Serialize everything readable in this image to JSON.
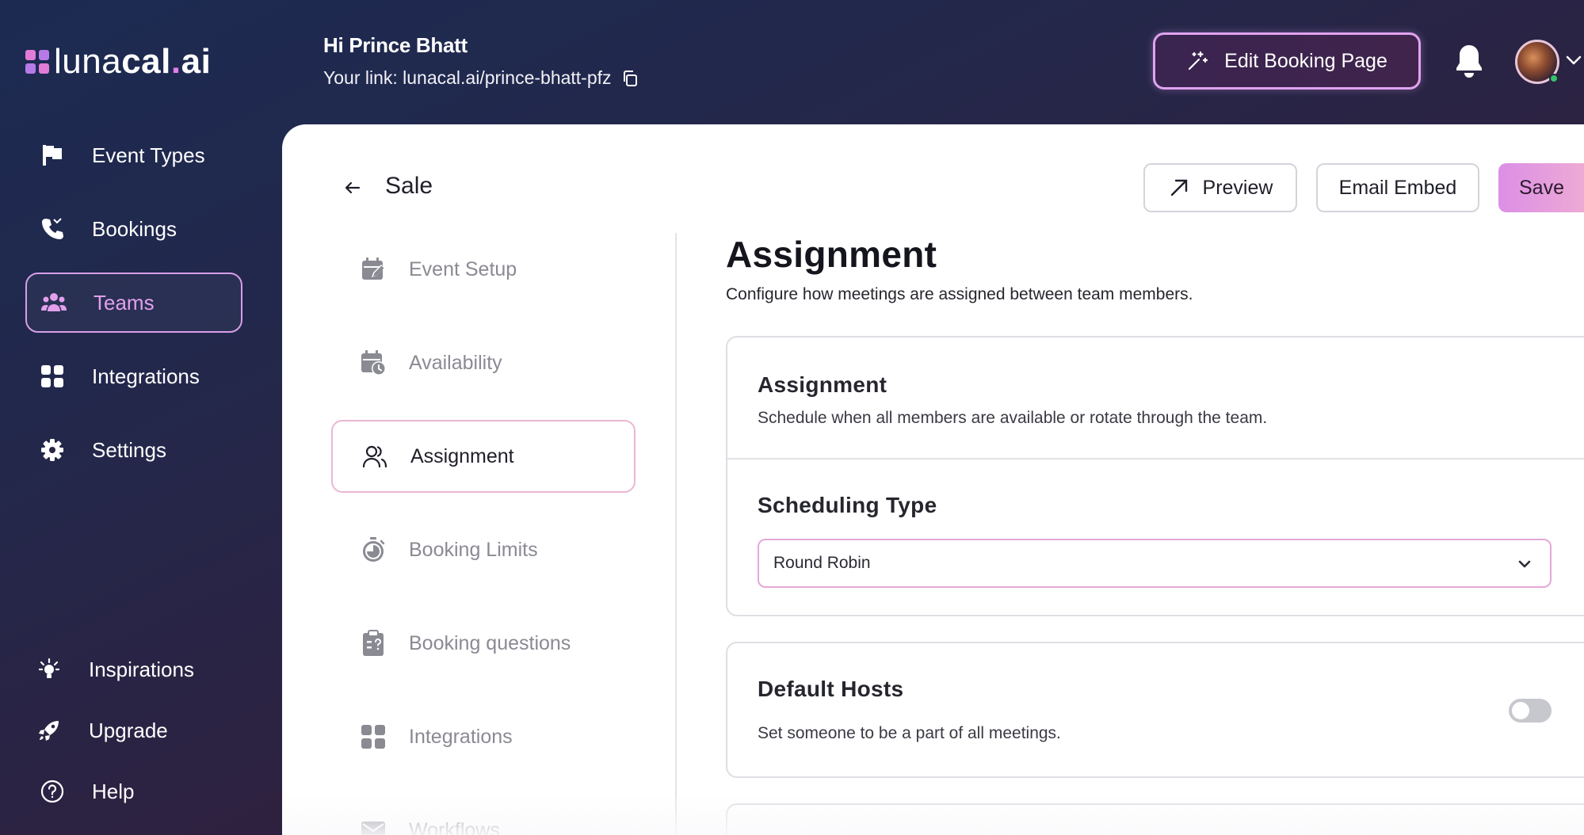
{
  "app": {
    "logo_prefix": "luna",
    "logo_bold": "cal",
    "logo_dot": ".",
    "logo_suffix": "ai"
  },
  "header": {
    "greeting": "Hi Prince Bhatt",
    "link_text": "Your link: lunacal.ai/prince-bhatt-pfz",
    "edit_button": "Edit Booking Page"
  },
  "sidebar": {
    "items": [
      {
        "label": "Event Types",
        "icon": "flag-icon"
      },
      {
        "label": "Bookings",
        "icon": "phone-icon"
      },
      {
        "label": "Teams",
        "icon": "team-icon",
        "active": true
      },
      {
        "label": "Integrations",
        "icon": "grid-icon"
      },
      {
        "label": "Settings",
        "icon": "gear-icon"
      }
    ],
    "bottom_items": [
      {
        "label": "Inspirations",
        "icon": "lightbulb-icon"
      },
      {
        "label": "Upgrade",
        "icon": "rocket-icon"
      },
      {
        "label": "Help",
        "icon": "help-icon"
      }
    ]
  },
  "page": {
    "title": "Sale",
    "preview_button": "Preview",
    "email_embed_button": "Email Embed",
    "save_button": "Save"
  },
  "subnav": {
    "items": [
      {
        "label": "Event Setup",
        "icon": "calendar-edit-icon"
      },
      {
        "label": "Availability",
        "icon": "calendar-clock-icon"
      },
      {
        "label": "Assignment",
        "icon": "users-icon",
        "active": true
      },
      {
        "label": "Booking Limits",
        "icon": "stopwatch-icon"
      },
      {
        "label": "Booking questions",
        "icon": "clipboard-question-icon"
      },
      {
        "label": "Integrations",
        "icon": "grid-icon"
      },
      {
        "label": "Workflows",
        "icon": "mail-icon"
      }
    ]
  },
  "content": {
    "heading": "Assignment",
    "subheading": "Configure how meetings are assigned between team members.",
    "assignment_card": {
      "title": "Assignment",
      "description": "Schedule when all members are available or rotate through the team.",
      "scheduling_title": "Scheduling Type",
      "scheduling_value": "Round Robin"
    },
    "default_hosts_card": {
      "title": "Default Hosts",
      "description": "Set someone to be a part of all meetings.",
      "toggle_on": false
    }
  },
  "colors": {
    "accent": "#d89ee8",
    "save_gradient_start": "#dc8fe6",
    "save_gradient_end": "#f2b2d0"
  }
}
